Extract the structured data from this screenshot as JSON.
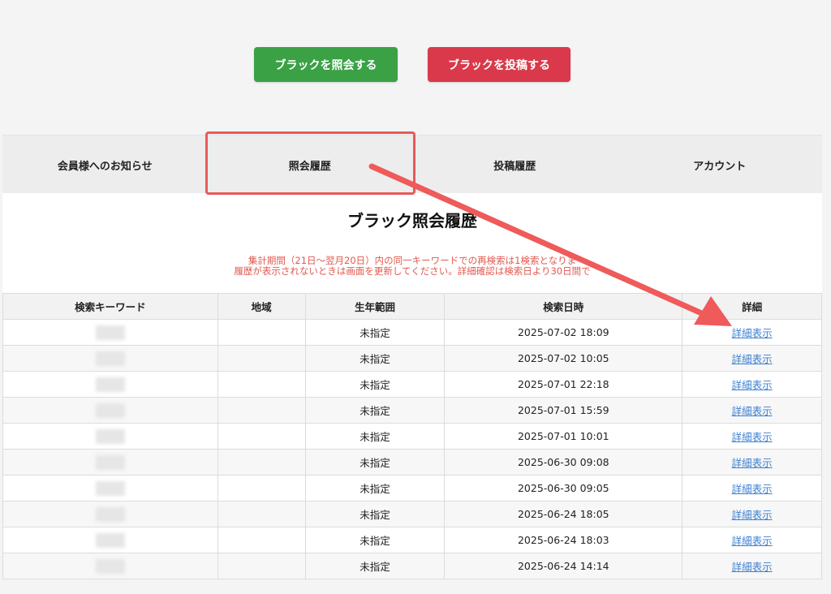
{
  "actions": {
    "inquire_label": "ブラックを照会する",
    "post_label": "ブラックを投稿する"
  },
  "tabs": [
    {
      "label": "会員様へのお知らせ"
    },
    {
      "label": "照会履歴"
    },
    {
      "label": "投稿履歴"
    },
    {
      "label": "アカウント"
    }
  ],
  "panel": {
    "title": "ブラック照会履歴",
    "notice_line1": "集計期間（21日～翌月20日）内の同一キーワードでの再検索は1検索となりま",
    "notice_line2": "履歴が表示されないときは画面を更新してください。詳細確認は検索日より30日間で"
  },
  "table": {
    "headers": [
      "検索キーワード",
      "地域",
      "生年範囲",
      "検索日時",
      "詳細"
    ],
    "rows": [
      {
        "region": "",
        "birth_range": "未指定",
        "datetime": "2025-07-02 18:09",
        "detail": "詳細表示"
      },
      {
        "region": "",
        "birth_range": "未指定",
        "datetime": "2025-07-02 10:05",
        "detail": "詳細表示"
      },
      {
        "region": "",
        "birth_range": "未指定",
        "datetime": "2025-07-01 22:18",
        "detail": "詳細表示"
      },
      {
        "region": "",
        "birth_range": "未指定",
        "datetime": "2025-07-01 15:59",
        "detail": "詳細表示"
      },
      {
        "region": "",
        "birth_range": "未指定",
        "datetime": "2025-07-01 10:01",
        "detail": "詳細表示"
      },
      {
        "region": "",
        "birth_range": "未指定",
        "datetime": "2025-06-30 09:08",
        "detail": "詳細表示"
      },
      {
        "region": "",
        "birth_range": "未指定",
        "datetime": "2025-06-30 09:05",
        "detail": "詳細表示"
      },
      {
        "region": "",
        "birth_range": "未指定",
        "datetime": "2025-06-24 18:05",
        "detail": "詳細表示"
      },
      {
        "region": "",
        "birth_range": "未指定",
        "datetime": "2025-06-24 18:03",
        "detail": "詳細表示"
      },
      {
        "region": "",
        "birth_range": "未指定",
        "datetime": "2025-06-24 14:14",
        "detail": "詳細表示"
      }
    ]
  },
  "colors": {
    "inquire_button": "#3aa144",
    "post_button": "#d9394a",
    "notice_text": "#e0594f",
    "link": "#3d7fd0",
    "annotation": "#e85a5a"
  }
}
